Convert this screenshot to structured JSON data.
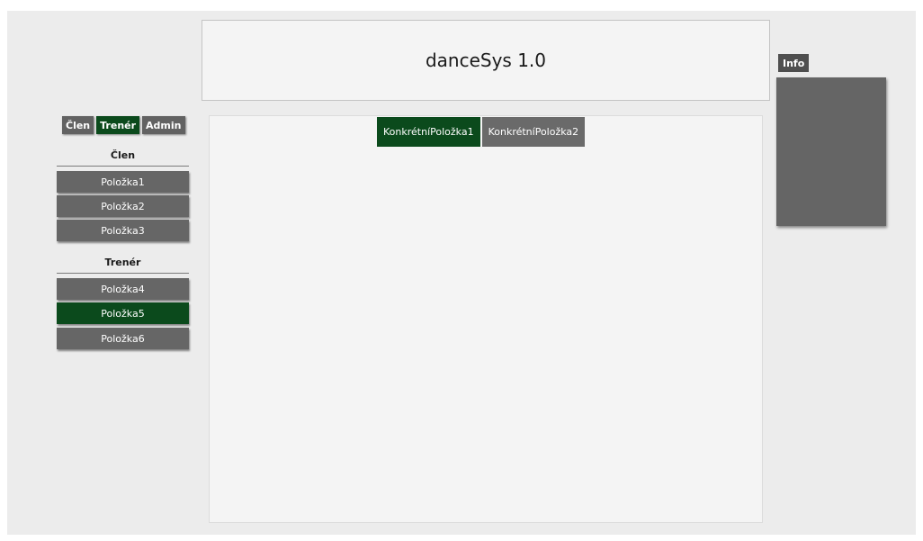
{
  "app": {
    "title": "danceSys 1.0"
  },
  "role_tabs": [
    {
      "label": "Člen",
      "active": false
    },
    {
      "label": "Trenér",
      "active": true
    },
    {
      "label": "Admin",
      "active": false
    }
  ],
  "sidebar": {
    "sections": [
      {
        "heading": "Člen",
        "items": [
          "Položka1",
          "Položka2",
          "Položka3"
        ]
      },
      {
        "heading": "Trenér",
        "items": [
          "Položka4",
          "Položka5",
          "Položka6"
        ]
      }
    ],
    "active_item": "Položka5"
  },
  "content_tabs": [
    {
      "label": "KonkrétníPoložka1",
      "active": true
    },
    {
      "label": "KonkrétníPoložka2",
      "active": false
    }
  ],
  "info": {
    "label": "Info"
  },
  "colors": {
    "active": "#0b4a1c",
    "inactive": "#666666",
    "background": "#ececec",
    "panel": "#f4f4f4"
  }
}
